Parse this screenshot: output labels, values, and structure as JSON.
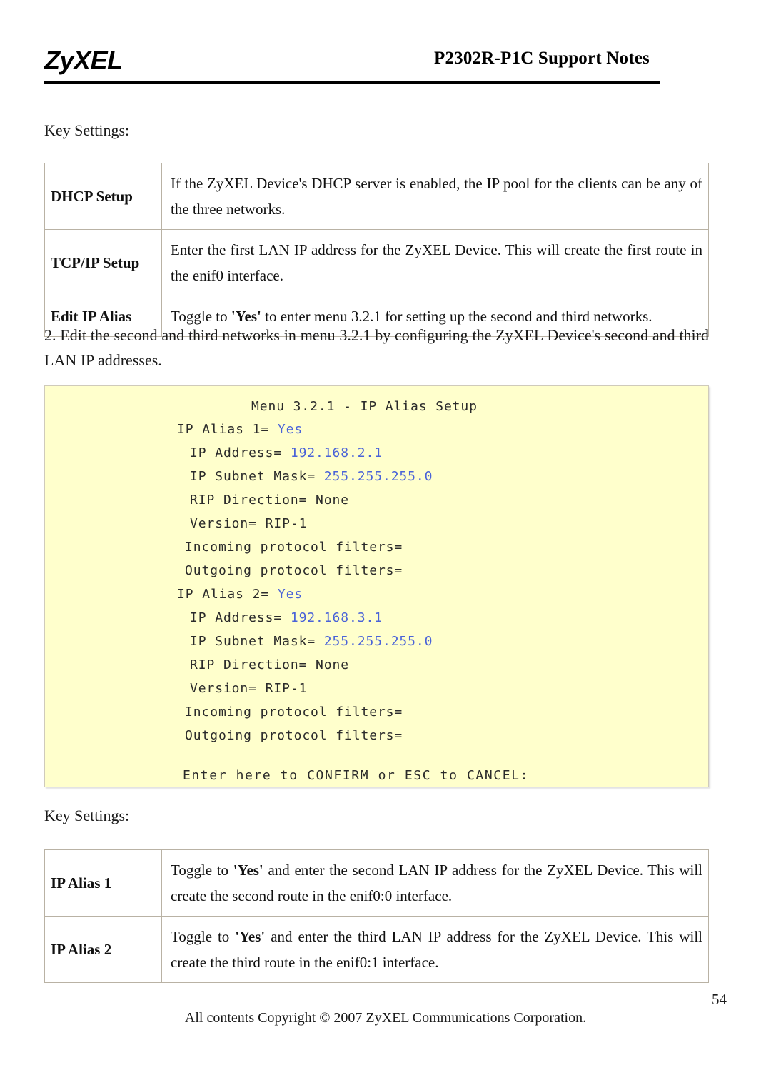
{
  "header": {
    "logo_text": "ZyXEL",
    "title": "P2302R-P1C Support Notes"
  },
  "section_one": {
    "key_settings_label": "Key Settings:",
    "table": {
      "rows": [
        {
          "key": "DHCP Setup",
          "value": "If the ZyXEL Device's DHCP server is enabled, the IP pool for the clients can be any of the three networks."
        },
        {
          "key": "TCP/IP Setup",
          "value": "Enter the first LAN IP address for the ZyXEL Device. This will create the first route in the enif0 interface."
        },
        {
          "key": "Edit IP Alias",
          "value_prefix": "Toggle to ",
          "value_bold": "'Yes'",
          "value_suffix": " to enter menu 3.2.1 for setting up the second and third networks."
        }
      ]
    }
  },
  "step_paragraph": "2. Edit the second and third networks in menu 3.2.1 by configuring the ZyXEL Device's second and third LAN IP addresses.",
  "console": {
    "title": "Menu 3.2.1 - IP Alias Setup",
    "lines": [
      {
        "label": "IP Alias 1= ",
        "value": "Yes"
      },
      {
        "label": "IP Address= ",
        "value": "192.168.2.1"
      },
      {
        "label": "IP Subnet Mask= ",
        "value": "255.255.255.0"
      },
      {
        "label": "RIP Direction= None",
        "value": ""
      },
      {
        "label": "Version= RIP-1",
        "value": ""
      },
      {
        "label": "Incoming protocol filters=",
        "value": ""
      },
      {
        "label": "Outgoing protocol filters=",
        "value": ""
      },
      {
        "label": "IP Alias 2= ",
        "value": "Yes"
      },
      {
        "label": "IP Address= ",
        "value": "192.168.3.1"
      },
      {
        "label": "IP Subnet Mask= ",
        "value": "255.255.255.0"
      },
      {
        "label": "RIP Direction= None",
        "value": ""
      },
      {
        "label": "Version= RIP-1",
        "value": ""
      },
      {
        "label": "Incoming protocol filters=",
        "value": ""
      },
      {
        "label": "Outgoing protocol filters=",
        "value": ""
      }
    ],
    "confirm_line": "Enter here to CONFIRM or ESC to CANCEL:",
    "background_color": "#ffffcc",
    "value_color": "#4a63d8"
  },
  "section_two": {
    "key_settings_label": "Key Settings:",
    "table": {
      "rows": [
        {
          "key": "IP Alias 1",
          "value_prefix": "Toggle to ",
          "value_bold": "'Yes'",
          "value_suffix": " and enter the second LAN IP address for the ZyXEL Device. This will create the second route in the enif0:0 interface."
        },
        {
          "key": "IP Alias 2",
          "value_prefix": "Toggle to ",
          "value_bold": "'Yes'",
          "value_suffix": " and enter the third LAN IP address for the ZyXEL Device. This will create the third route in the enif0:1 interface."
        }
      ]
    }
  },
  "footer": {
    "page_number": "54",
    "copyright": "All contents Copyright © 2007 ZyXEL Communications Corporation."
  }
}
